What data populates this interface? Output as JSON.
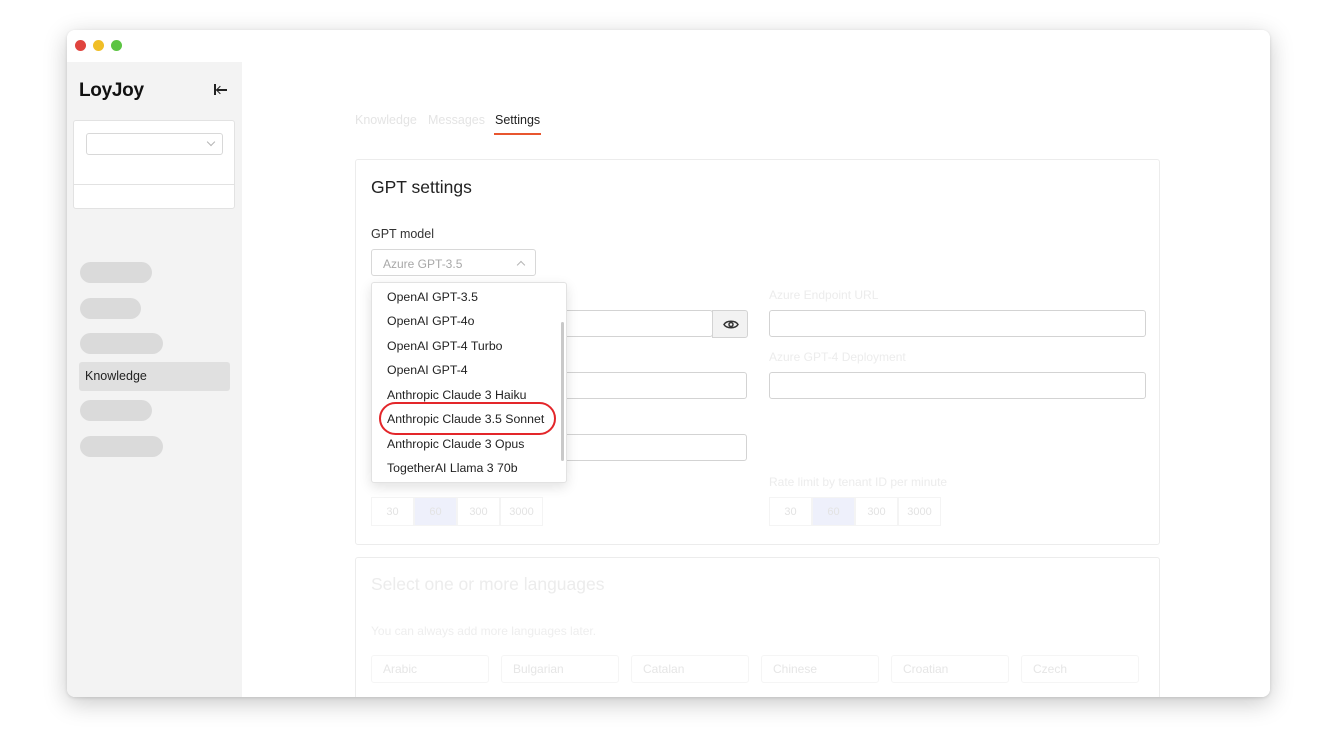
{
  "app": {
    "brand": "LoyJoy"
  },
  "sidebar": {
    "active_item": "Knowledge"
  },
  "tabs": [
    {
      "label": "Knowledge",
      "active": false
    },
    {
      "label": "Messages",
      "active": false
    },
    {
      "label": "Settings",
      "active": true
    }
  ],
  "gpt_settings": {
    "title": "GPT settings",
    "model_label": "GPT model",
    "model_value": "Azure GPT-3.5",
    "faint_labels": {
      "endpoint": "Azure Endpoint URL",
      "deployment": "Azure GPT-4 Deployment",
      "rate_limit_tenant": "Rate limit by tenant ID per minute"
    },
    "rate_options_left": [
      "30",
      "60",
      "300",
      "3000"
    ],
    "rate_options_right": [
      "30",
      "60",
      "300",
      "3000"
    ],
    "selected_rate": "60"
  },
  "model_options": [
    "OpenAI GPT-3.5",
    "OpenAI GPT-4o",
    "OpenAI GPT-4 Turbo",
    "OpenAI GPT-4",
    "Anthropic Claude 3 Haiku",
    "Anthropic Claude 3.5 Sonnet",
    "Anthropic Claude 3 Opus",
    "TogetherAI Llama 3 70b"
  ],
  "highlighted_option": "Anthropic Claude 3.5 Sonnet",
  "languages": {
    "title": "Select one or more languages",
    "subtitle": "You can always add more languages later.",
    "items": [
      "Arabic",
      "Bulgarian",
      "Catalan",
      "Chinese",
      "Croatian",
      "Czech"
    ]
  },
  "colors": {
    "accent_underline": "#e8562f",
    "highlight_ring": "#e3262a",
    "selected_segment": "#eef0fb"
  },
  "icons": {
    "collapse": "collapse-sidebar-icon",
    "reveal": "eye-icon"
  }
}
